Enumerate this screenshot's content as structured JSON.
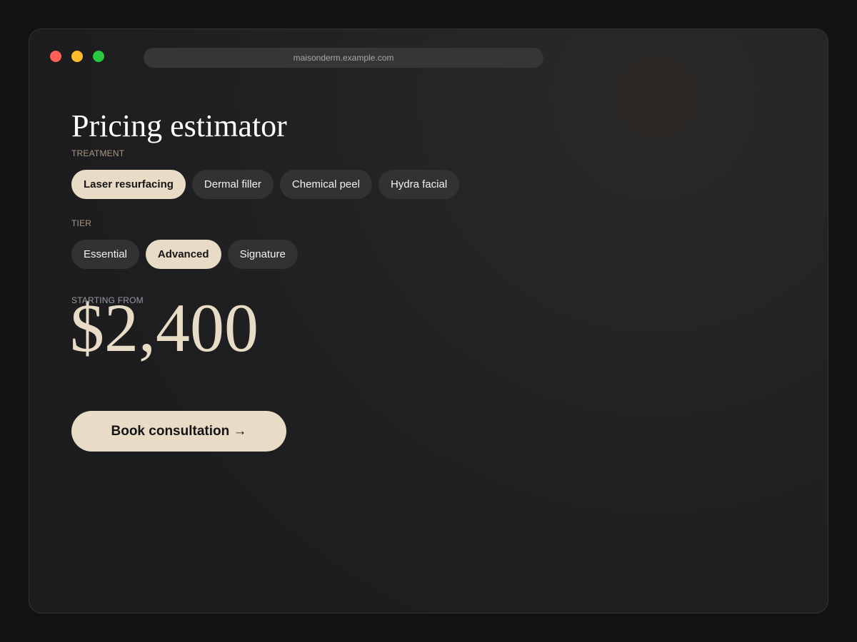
{
  "browser": {
    "url": "maisonderm.example.com"
  },
  "page": {
    "title": "Pricing estimator"
  },
  "treatment": {
    "label": "TREATMENT",
    "options": [
      "Laser resurfacing",
      "Dermal filler",
      "Chemical peel",
      "Hydra facial"
    ],
    "selected": "Laser resurfacing"
  },
  "tier": {
    "label": "TIER",
    "options": [
      "Essential",
      "Advanced",
      "Signature"
    ],
    "selected": "Advanced"
  },
  "estimate": {
    "label": "STARTING FROM",
    "price": "$2,400"
  },
  "cta": {
    "label": "Book consultation →"
  },
  "colors": {
    "accent": "#e8dcc7",
    "chip": "#323234",
    "label": "#a9967f"
  }
}
